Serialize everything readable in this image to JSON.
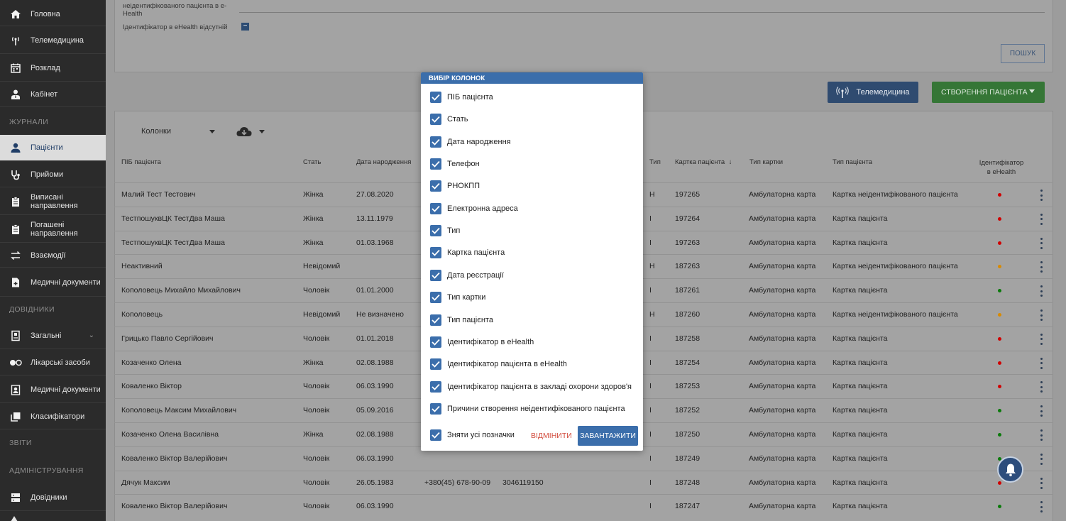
{
  "sidebar": {
    "items": [
      {
        "label": "Головна",
        "icon": "home-icon"
      },
      {
        "label": "Телемедицина",
        "icon": "antenna-icon"
      },
      {
        "label": "Розклад",
        "icon": "calendar-icon"
      },
      {
        "label": "Кабінет",
        "icon": "doctor-icon"
      },
      {
        "label": "Пацієнти",
        "icon": "person-icon"
      },
      {
        "label": "Прийоми",
        "icon": "stethoscope-icon"
      },
      {
        "label": "Виписані направлення",
        "icon": "clipboard-icon"
      },
      {
        "label": "Погашені направлення",
        "icon": "clipboard-icon"
      },
      {
        "label": "Взаємодії",
        "icon": "swap-icon"
      },
      {
        "label": "Медичні документи",
        "icon": "document-plus-icon"
      },
      {
        "label": "Загальні",
        "icon": "book-icon"
      },
      {
        "label": "Лікарські засоби",
        "icon": "pills-icon"
      },
      {
        "label": "Медичні документи",
        "icon": "medical-folder-icon"
      },
      {
        "label": "Класифікатори",
        "icon": "layers-icon"
      },
      {
        "label": "Довідники",
        "icon": "table-icon"
      }
    ],
    "sections": {
      "journals": "ЖУРНАЛИ",
      "references": "ДОВІДНИКИ",
      "reports": "ЗВІТИ",
      "admin": "АДМІНІСТРУВАННЯ"
    }
  },
  "filters": {
    "field_label": "неідентифікованого пацієнта в e-Health",
    "checkbox_label": "Ідентифікатор в eHealth відсутній",
    "search_button": "ПОШУК"
  },
  "actions": {
    "telemedicine": "Телемедицина",
    "create_patient": "СТВОРЕННЯ ПАЦІЄНТА"
  },
  "toolbar": {
    "columns": "Колонки"
  },
  "table": {
    "headers": {
      "name": "ПІБ пацієнта",
      "sex": "Стать",
      "dob": "Дата народження",
      "type": "Тип",
      "card": "Картка пацієнта",
      "card_type": "Тип картки",
      "patient_type": "Тип пацієнта",
      "ehealth": "Ідентифікатор в eHealth"
    },
    "rows": [
      {
        "name": "Малий Тест Тестович",
        "sex": "Жінка",
        "dob": "27.08.2020",
        "phone": "",
        "rnokpp": "",
        "type": "Н",
        "card": "197265",
        "card_type": "Амбулаторна карта",
        "patient_type": "Картка неідентифікованого пацієнта",
        "status": "red"
      },
      {
        "name": "ТестпошуквЦК ТестДва Маша",
        "sex": "Жінка",
        "dob": "13.11.1979",
        "phone": "",
        "rnokpp": "",
        "type": "І",
        "card": "197264",
        "card_type": "Амбулаторна карта",
        "patient_type": "Картка пацієнта",
        "status": "red"
      },
      {
        "name": "ТестпошуквЦК ТестДва Маша",
        "sex": "Жінка",
        "dob": "01.03.1968",
        "phone": "",
        "rnokpp": "",
        "type": "І",
        "card": "197263",
        "card_type": "Амбулаторна карта",
        "patient_type": "Картка пацієнта",
        "status": "red"
      },
      {
        "name": "Неактивний",
        "sex": "Невідомий",
        "dob": "",
        "phone": "",
        "rnokpp": "",
        "type": "Н",
        "card": "187263",
        "card_type": "Амбулаторна карта",
        "patient_type": "Картка неідентифікованого пацієнта",
        "status": "orange"
      },
      {
        "name": "Кополовець Михайло Михайлович",
        "sex": "Чоловік",
        "dob": "01.01.2000",
        "phone": "",
        "rnokpp": "",
        "type": "І",
        "card": "187261",
        "card_type": "Амбулаторна карта",
        "patient_type": "Картка пацієнта",
        "status": "green"
      },
      {
        "name": "Кополовець",
        "sex": "Невідомий",
        "dob": "Не визначено",
        "phone": "",
        "rnokpp": "",
        "type": "Н",
        "card": "187260",
        "card_type": "Амбулаторна карта",
        "patient_type": "Картка неідентифікованого пацієнта",
        "status": "orange"
      },
      {
        "name": "Грицько Павло Сергійович",
        "sex": "Чоловік",
        "dob": "01.01.2018",
        "phone": "",
        "rnokpp": "",
        "type": "І",
        "card": "187258",
        "card_type": "Амбулаторна карта",
        "patient_type": "Картка пацієнта",
        "status": "red"
      },
      {
        "name": "Козаченко Олена",
        "sex": "Жінка",
        "dob": "02.08.1988",
        "phone": "",
        "rnokpp": "",
        "type": "І",
        "card": "187254",
        "card_type": "Амбулаторна карта",
        "patient_type": "Картка пацієнта",
        "status": "red"
      },
      {
        "name": "Коваленко Віктор",
        "sex": "Чоловік",
        "dob": "06.03.1990",
        "phone": "",
        "rnokpp": "",
        "type": "І",
        "card": "187253",
        "card_type": "Амбулаторна карта",
        "patient_type": "Картка пацієнта",
        "status": "red"
      },
      {
        "name": "Кополовець Максим Михайлович",
        "sex": "Чоловік",
        "dob": "05.09.2016",
        "phone": "",
        "rnokpp": "",
        "type": "І",
        "card": "187252",
        "card_type": "Амбулаторна карта",
        "patient_type": "Картка пацієнта",
        "status": "green"
      },
      {
        "name": "Козаченко Олена Василівна",
        "sex": "Жінка",
        "dob": "02.08.1988",
        "phone": "",
        "rnokpp": "",
        "type": "І",
        "card": "187250",
        "card_type": "Амбулаторна карта",
        "patient_type": "Картка пацієнта",
        "status": "green"
      },
      {
        "name": "Коваленко Віктор Валерійович",
        "sex": "Чоловік",
        "dob": "06.03.1990",
        "phone": "",
        "rnokpp": "",
        "type": "І",
        "card": "187249",
        "card_type": "Амбулаторна карта",
        "patient_type": "Картка пацієнта",
        "status": "green"
      },
      {
        "name": "Дячук Максим",
        "sex": "Чоловік",
        "dob": "26.05.1983",
        "phone": "+380(45) 678-90-09",
        "rnokpp": "3046119150",
        "type": "І",
        "card": "187248",
        "card_type": "Амбулаторна карта",
        "patient_type": "Картка пацієнта",
        "status": "red"
      },
      {
        "name": "Коваленко Віктор Валерійович",
        "sex": "Чоловік",
        "dob": "06.03.1990",
        "phone": "",
        "rnokpp": "",
        "type": "І",
        "card": "187247",
        "card_type": "Амбулаторна карта",
        "patient_type": "Картка пацієнта",
        "status": "green"
      }
    ]
  },
  "modal": {
    "title": "ВИБІР КОЛОНОК",
    "options": [
      {
        "label": "ПІБ пацієнта",
        "checked": true
      },
      {
        "label": "Стать",
        "checked": true
      },
      {
        "label": "Дата народження",
        "checked": true
      },
      {
        "label": "Телефон",
        "checked": true
      },
      {
        "label": "РНОКПП",
        "checked": true
      },
      {
        "label": "Електронна адреса",
        "checked": true
      },
      {
        "label": "Тип",
        "checked": true
      },
      {
        "label": "Картка пацієнта",
        "checked": true
      },
      {
        "label": "Дата реєстрації",
        "checked": true
      },
      {
        "label": "Тип картки",
        "checked": true
      },
      {
        "label": "Тип пацієнта",
        "checked": true
      },
      {
        "label": "Ідентифікатор в eHealth",
        "checked": true
      },
      {
        "label": "Ідентифікатор пацієнта в eHealth",
        "checked": true
      },
      {
        "label": "Ідентифікатор пацієнта в закладі охорони здоров'я",
        "checked": true
      },
      {
        "label": "Причини створення неідентифікованого пацієнта",
        "checked": true
      }
    ],
    "clear_all": "Зняти усі позначки",
    "cancel": "ВІДМІНИТИ",
    "load": "ЗАВАНТАЖИТИ"
  },
  "colors": {
    "sidebar_bg": "#2b2b2b",
    "accent": "#3b6eab",
    "create_green": "#357636",
    "status_red": "#d10000",
    "status_orange": "#d98a00",
    "status_green": "#0a7a0a",
    "cancel_red": "#d24b3c"
  }
}
